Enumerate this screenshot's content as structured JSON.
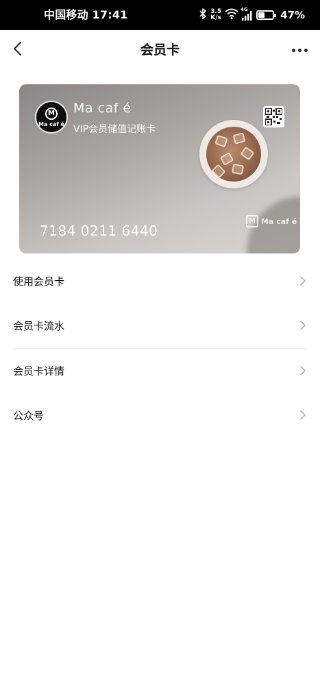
{
  "status_bar": {
    "carrier_time": "中国移动 17:41",
    "net_speed_value": "3.5",
    "net_speed_unit": "K/s",
    "network_type": "4G",
    "battery_level": 0.47,
    "battery_text": "47%"
  },
  "nav": {
    "title": "会员卡"
  },
  "card": {
    "brand_name": "Ma caf é",
    "logo_text": "Ma caf é",
    "logo_mark": "M",
    "subtitle": "VIP会员储值记账卡",
    "card_number": "7184 0211 6440",
    "watermark_mark": "M",
    "watermark_text": "Ma caf é"
  },
  "menu": {
    "items": [
      {
        "label": "使用会员卡"
      },
      {
        "label": "会员卡流水"
      },
      {
        "label": "会员卡详情"
      },
      {
        "label": "公众号"
      }
    ]
  },
  "colors": {
    "status_bar_bg": "#000000",
    "page_bg": "#ffffff",
    "divider": "#e7e7e7",
    "chevron": "#b3b3b3"
  },
  "icons": [
    "bluetooth-icon",
    "wifi-icon",
    "signal-icon",
    "battery-icon",
    "back-chevron-icon",
    "more-dots-icon",
    "qr-code-icon",
    "chevron-right-icon"
  ]
}
